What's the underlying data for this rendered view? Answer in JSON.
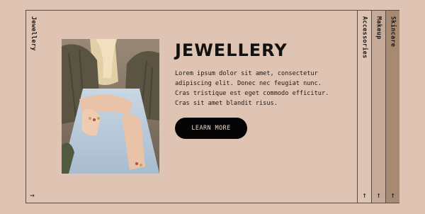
{
  "left_tab": {
    "label": "Jewellery",
    "arrow": "→"
  },
  "right_tabs": [
    {
      "label": "Accessories",
      "arrow": "↑",
      "bg": "#dfc3b3"
    },
    {
      "label": "Makeup",
      "arrow": "↑",
      "bg": "#c5aa98"
    },
    {
      "label": "Skincare",
      "arrow": "↑",
      "bg": "#a88a72"
    }
  ],
  "main": {
    "title": "JEWELLERY",
    "description": "Lorem ipsum dolor sit amet, consectetur adipiscing elit. Donec nec feugiat nunc. Cras tristique est eget commodo efficitur. Cras sit amet blandit risus.",
    "button_label": "LEARN MORE"
  },
  "colors": {
    "background": "#dfc3b3",
    "border": "#5a4a42",
    "button_bg": "#050505",
    "button_text": "#e6d5cb"
  }
}
